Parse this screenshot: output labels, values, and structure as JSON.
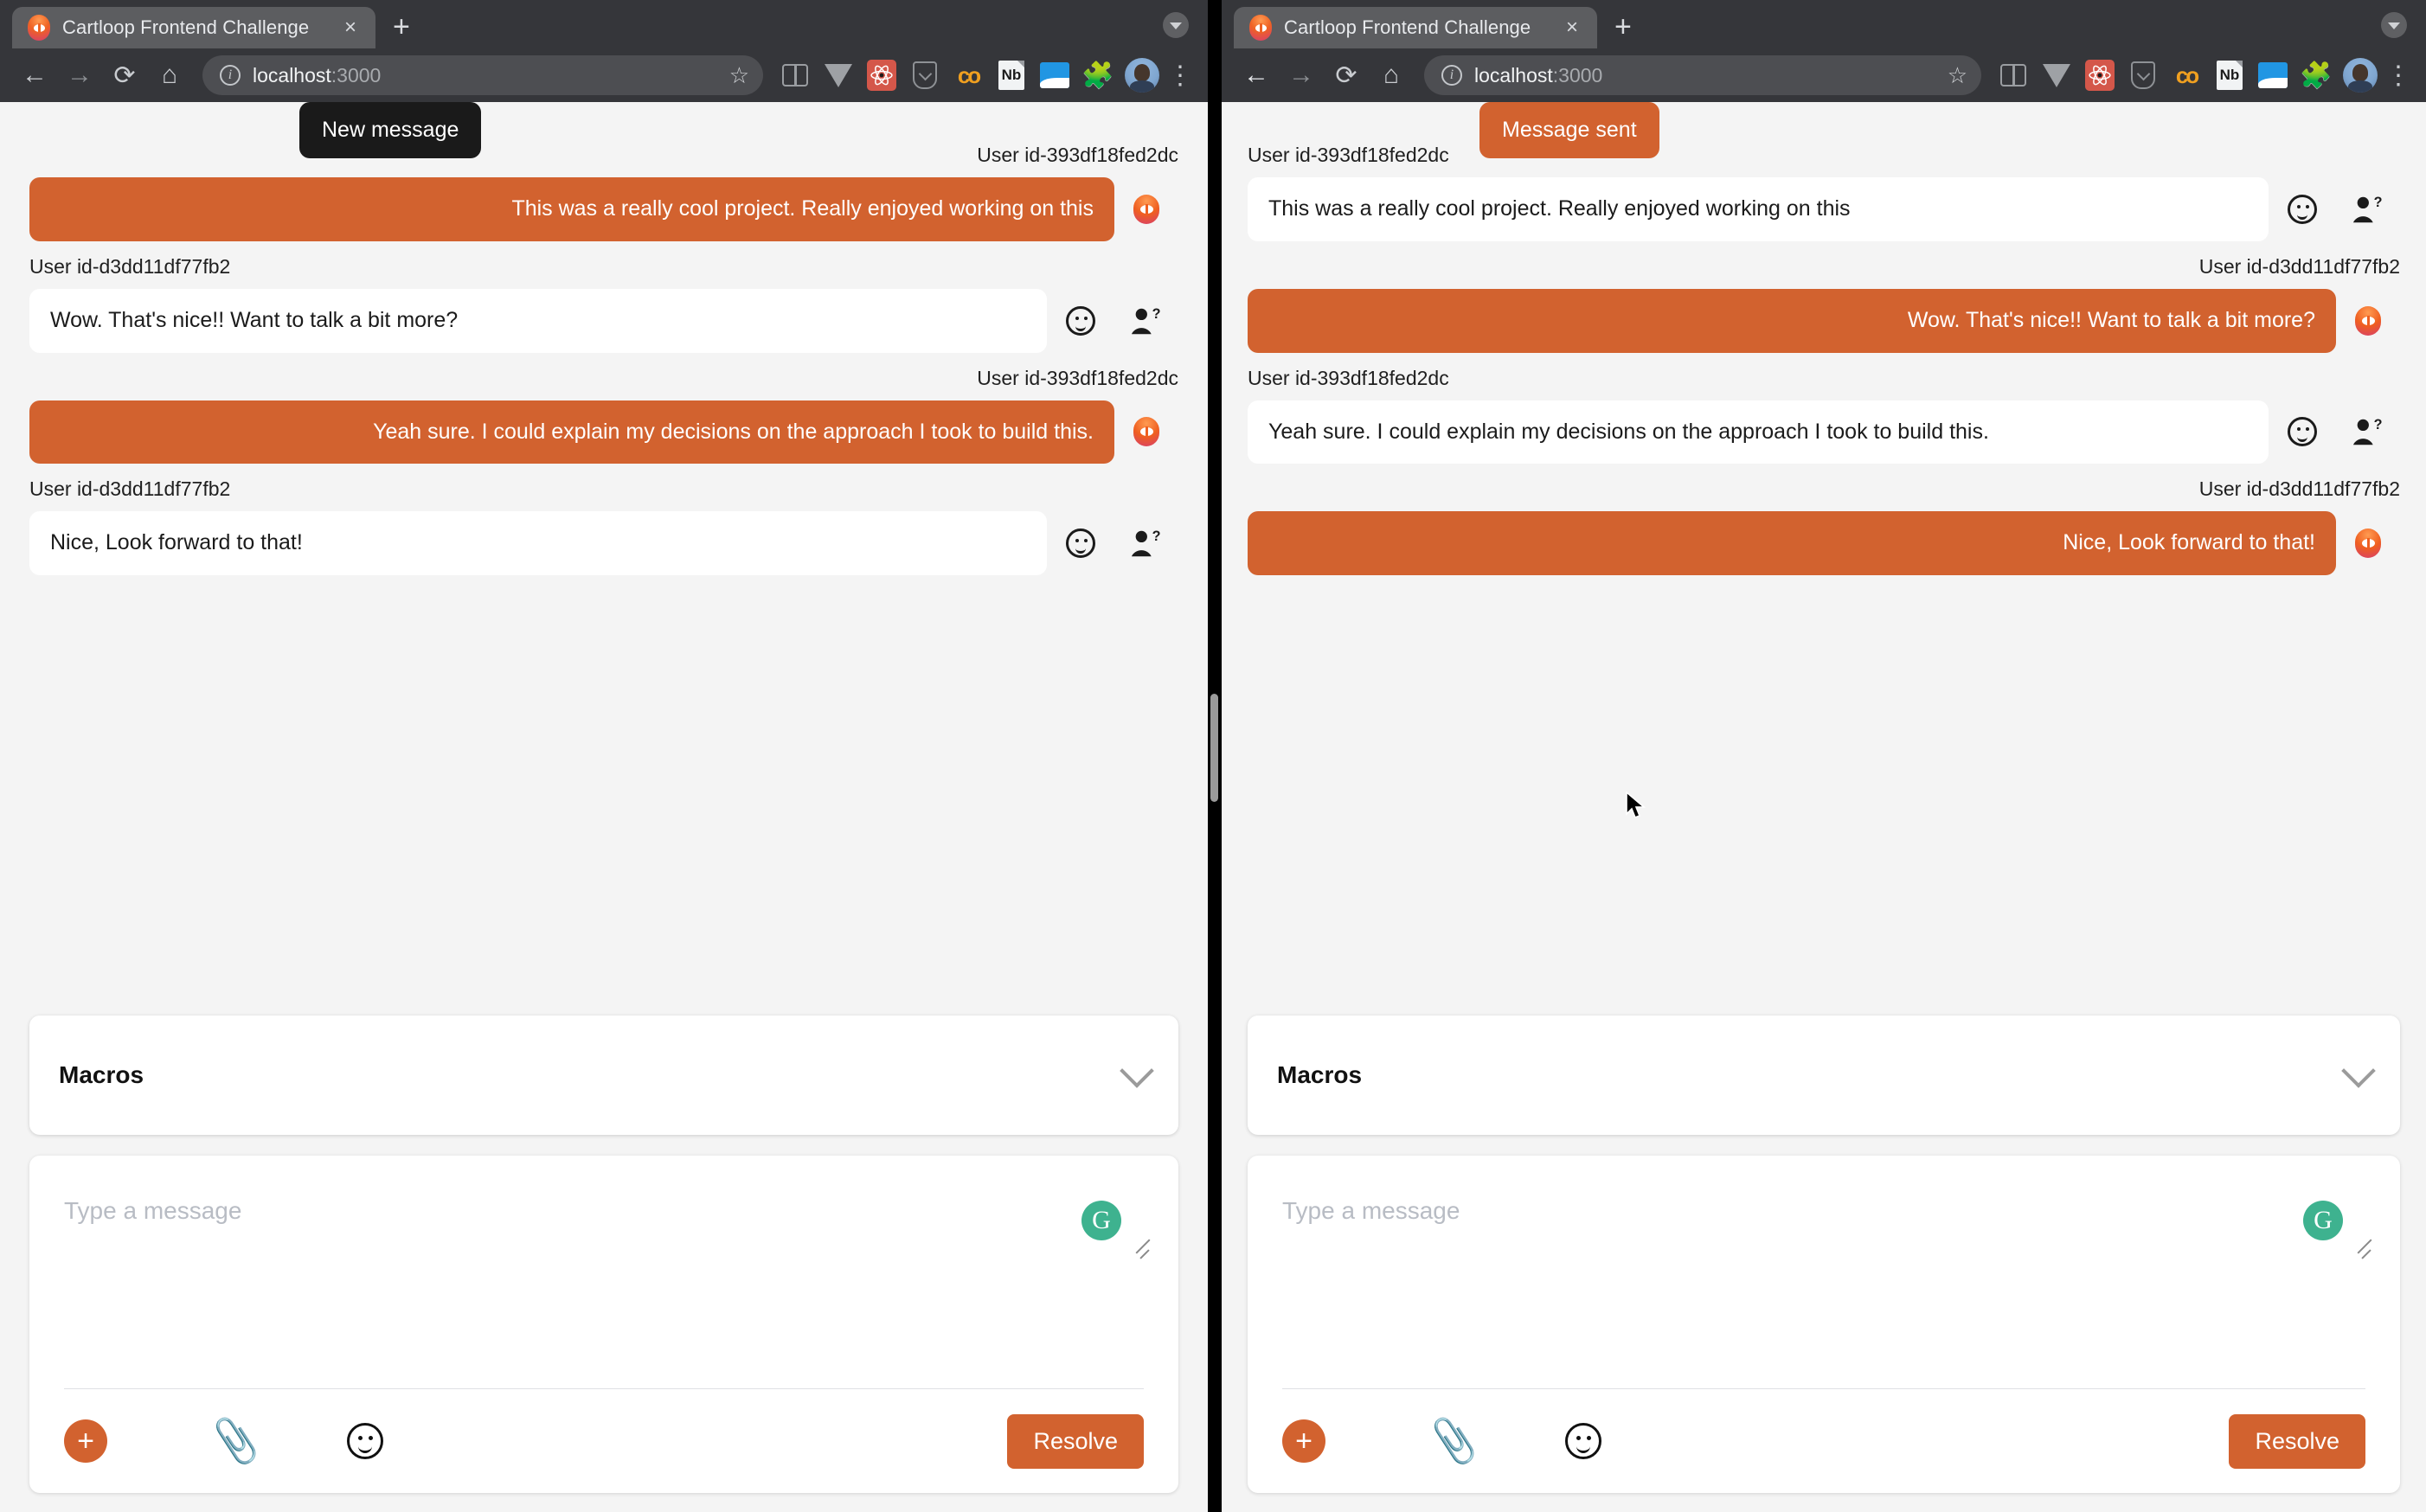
{
  "browser": {
    "tab_title": "Cartloop Frontend Challenge",
    "tab_close": "×",
    "new_tab": "+",
    "url_host": "localhost",
    "url_port": ":3000",
    "info_glyph": "i",
    "star_glyph": "☆",
    "kebab_glyph": "⋮",
    "nav": {
      "back": "←",
      "forward": "→",
      "reload": "⟳",
      "home": "⌂"
    },
    "extensions": [
      "split-view-icon",
      "vue-devtools-icon",
      "react-devtools-icon",
      "pocket-icon",
      "colorzilla-icon",
      "notebook-icon",
      "image-tool-icon",
      "puzzle-extensions-icon",
      "profile-avatar-icon"
    ]
  },
  "left_panel": {
    "tooltip": {
      "text": "New message",
      "style": "dark"
    },
    "messages": [
      {
        "user": "User id-393df18fed2dc",
        "text": "This was a really cool project. Really enjoyed working on this",
        "dir": "out",
        "align": "right"
      },
      {
        "user": "User id-d3dd11df77fb2",
        "text": "Wow. That's nice!! Want to talk a bit more?",
        "dir": "in",
        "align": "left"
      },
      {
        "user": "User id-393df18fed2dc",
        "text": "Yeah sure. I could explain my decisions on the approach I took to build this.",
        "dir": "out",
        "align": "right"
      },
      {
        "user": "User id-d3dd11df77fb2",
        "text": "Nice, Look forward to that!",
        "dir": "in",
        "align": "left"
      }
    ],
    "macros": {
      "title": "Macros"
    },
    "composer": {
      "placeholder": "Type a message",
      "value": "",
      "grammarly": "G",
      "plus": "+",
      "attach": "📎",
      "resolve_label": "Resolve"
    }
  },
  "right_panel": {
    "tooltip": {
      "text": "Message sent",
      "style": "orange"
    },
    "messages": [
      {
        "user": "User id-393df18fed2dc",
        "text": "This was a really cool project. Really enjoyed working on this",
        "dir": "in",
        "align": "left"
      },
      {
        "user": "User id-d3dd11df77fb2",
        "text": "Wow. That's nice!! Want to talk a bit more?",
        "dir": "out",
        "align": "right"
      },
      {
        "user": "User id-393df18fed2dc",
        "text": "Yeah sure. I could explain my decisions on the approach I took to build this.",
        "dir": "in",
        "align": "left"
      },
      {
        "user": "User id-d3dd11df77fb2",
        "text": "Nice, Look forward to that!",
        "dir": "out",
        "align": "right"
      }
    ],
    "macros": {
      "title": "Macros"
    },
    "composer": {
      "placeholder": "Type a message",
      "value": "",
      "grammarly": "G",
      "plus": "+",
      "attach": "📎",
      "resolve_label": "Resolve"
    }
  },
  "colors": {
    "accent_orange": "#d2622f",
    "tooltip_dark": "#1a1a1a",
    "page_bg": "#f4f4f4",
    "grammarly_green": "#3eb28f",
    "chrome_bg": "#35363a"
  }
}
